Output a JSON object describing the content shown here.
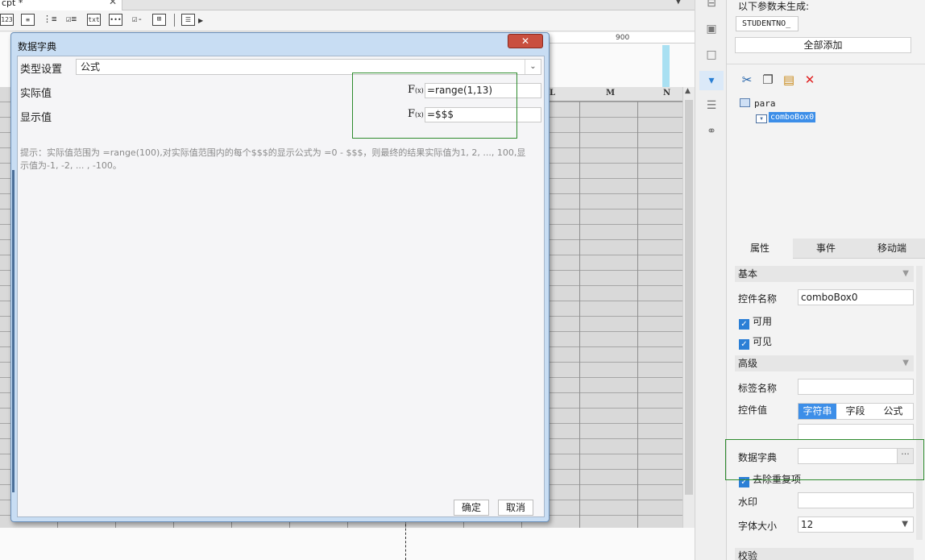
{
  "file_tab": {
    "label": "cpt *",
    "close": "✕"
  },
  "toolbar": {
    "icons": [
      "number-field-icon",
      "text-area-icon",
      "radio-group-icon",
      "checkbox-group-icon",
      "text-label-icon",
      "password-field-icon",
      "checkbox-icon",
      "tree-icon",
      "more-icon"
    ],
    "label_123": "123",
    "label_txt": "txt",
    "label_dots": "•••"
  },
  "ruler": {
    "tick_900": "900"
  },
  "sheet": {
    "columns": [
      "L",
      "M",
      "N"
    ]
  },
  "dialog": {
    "title": "数据字典",
    "close_label": "✕",
    "type_label": "类型设置",
    "type_value": "公式",
    "actual_label": "实际值",
    "actual_formula": "=range(1,13)",
    "display_label": "显示值",
    "display_formula": "=$$$",
    "fx_big": "F",
    "fx_small": "(x)",
    "tip": "提示：实际值范围为 =range(100),对实际值范围内的每个$$$的显示公式为 =0 - $$$，则最终的结果实际值为1, 2, ..., 100,显示值为-1, -2, ... , -100。",
    "ok_label": "确定",
    "cancel_label": "取消"
  },
  "right_panel": {
    "missing_params_label": "以下参数未生成:",
    "missing_param": "STUDENTNO_",
    "add_all_label": "全部添加",
    "tree": {
      "root": "para",
      "child": "comboBox0"
    },
    "tabs": [
      "属性",
      "事件",
      "移动端"
    ],
    "basic_section": "基本",
    "control_name_label": "控件名称",
    "control_name_value": "comboBox0",
    "enabled_label": "可用",
    "visible_label": "可见",
    "advanced_section": "高级",
    "tag_name_label": "标签名称",
    "control_value_label": "控件值",
    "value_modes": [
      "字符串",
      "字段",
      "公式"
    ],
    "dictionary_label": "数据字典",
    "dictionary_btn": "···",
    "dedupe_label": "去除重复项",
    "watermark_label": "水印",
    "font_size_label": "字体大小",
    "font_size_value": "12",
    "validation_section": "校验"
  },
  "colors": {
    "accent": "#3c8ee8",
    "highlight": "#2e8b2e",
    "dialog_frame": "#c8ddf3",
    "close_red": "#c94f3f"
  }
}
